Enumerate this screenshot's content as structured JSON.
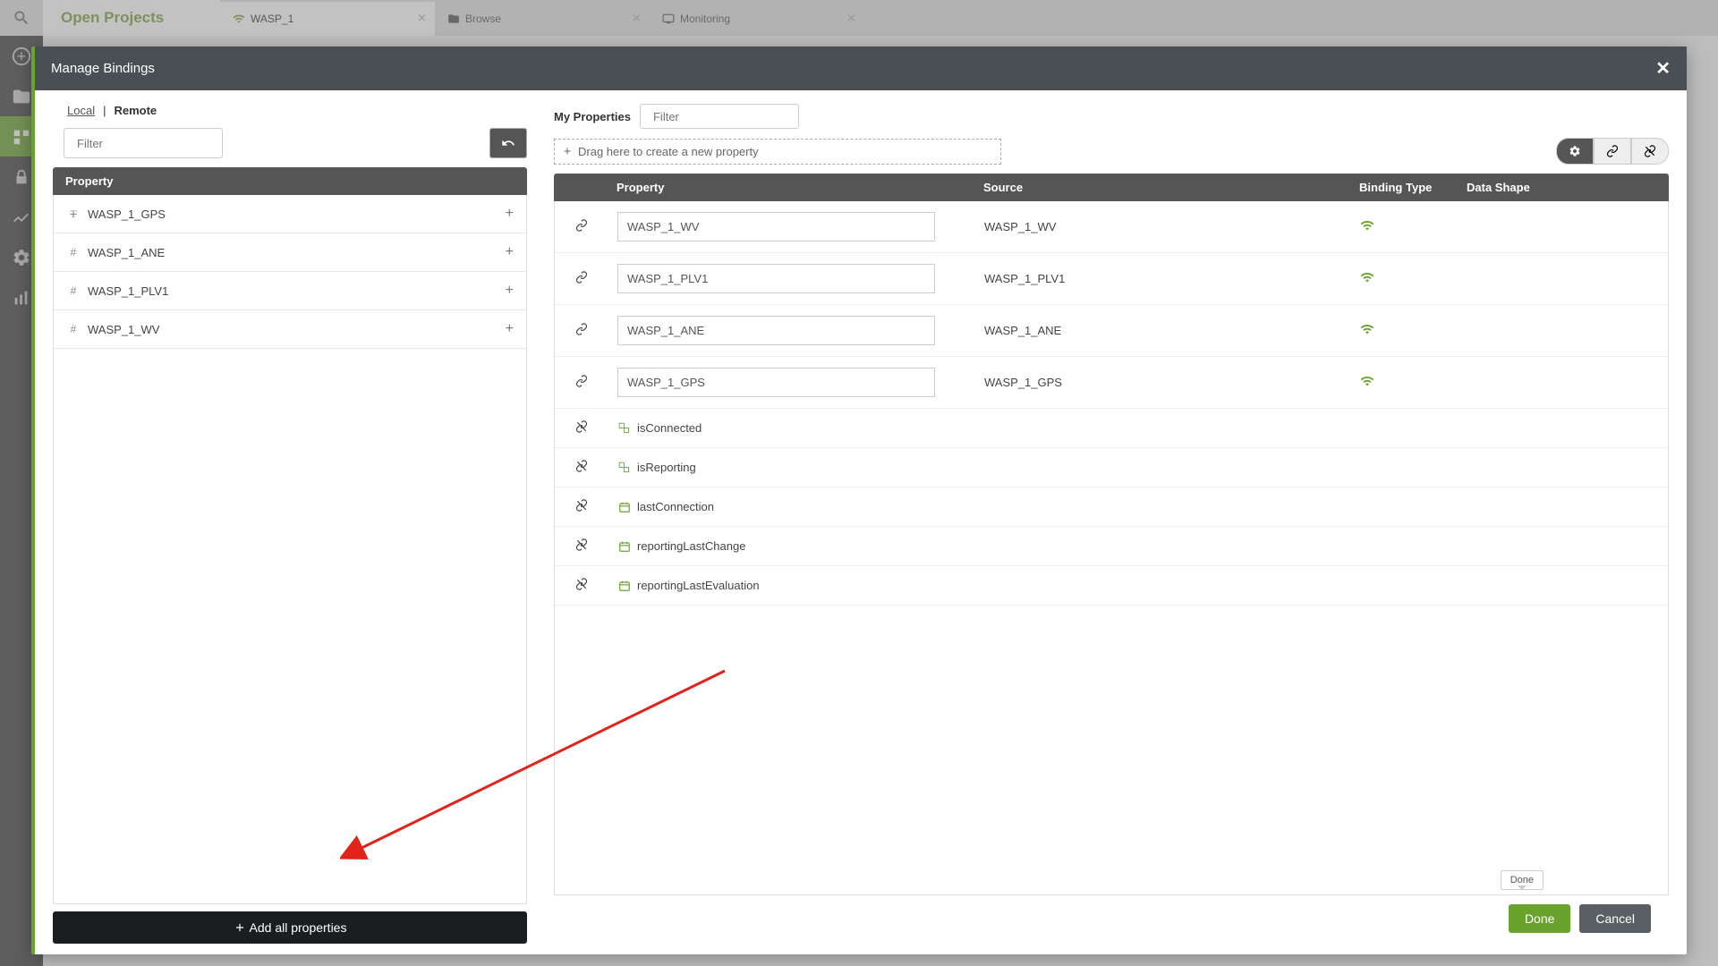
{
  "background": {
    "openProjects": "Open Projects",
    "tabs": [
      {
        "label": "WASP_1",
        "icon": "wifi",
        "active": true
      },
      {
        "label": "Browse",
        "icon": "folder",
        "active": false
      },
      {
        "label": "Monitoring",
        "icon": "monitor",
        "active": false
      }
    ]
  },
  "modal": {
    "title": "Manage Bindings",
    "leftTabs": {
      "local": "Local",
      "remote": "Remote"
    },
    "filterPlaceholder": "Filter",
    "propertyHeader": "Property",
    "localProperties": [
      {
        "icon": "T",
        "name": "WASP_1_GPS"
      },
      {
        "icon": "#",
        "name": "WASP_1_ANE"
      },
      {
        "icon": "#",
        "name": "WASP_1_PLV1"
      },
      {
        "icon": "#",
        "name": "WASP_1_WV"
      }
    ],
    "addAllLabel": "Add all properties",
    "myPropertiesLabel": "My Properties",
    "dragHint": "Drag here to create a new property",
    "gridHeaders": {
      "c2": "Property",
      "c3": "Source",
      "c4": "Binding Type",
      "c5": "Data Shape"
    },
    "bindings": [
      {
        "property": "WASP_1_WV",
        "source": "WASP_1_WV"
      },
      {
        "property": "WASP_1_PLV1",
        "source": "WASP_1_PLV1"
      },
      {
        "property": "WASP_1_ANE",
        "source": "WASP_1_ANE"
      },
      {
        "property": "WASP_1_GPS",
        "source": "WASP_1_GPS"
      }
    ],
    "staticProps": [
      {
        "icon": "bool",
        "name": "isConnected"
      },
      {
        "icon": "bool",
        "name": "isReporting"
      },
      {
        "icon": "date",
        "name": "lastConnection"
      },
      {
        "icon": "date",
        "name": "reportingLastChange"
      },
      {
        "icon": "date",
        "name": "reportingLastEvaluation"
      }
    ],
    "tooltipDone": "Done",
    "buttons": {
      "done": "Done",
      "cancel": "Cancel"
    }
  }
}
